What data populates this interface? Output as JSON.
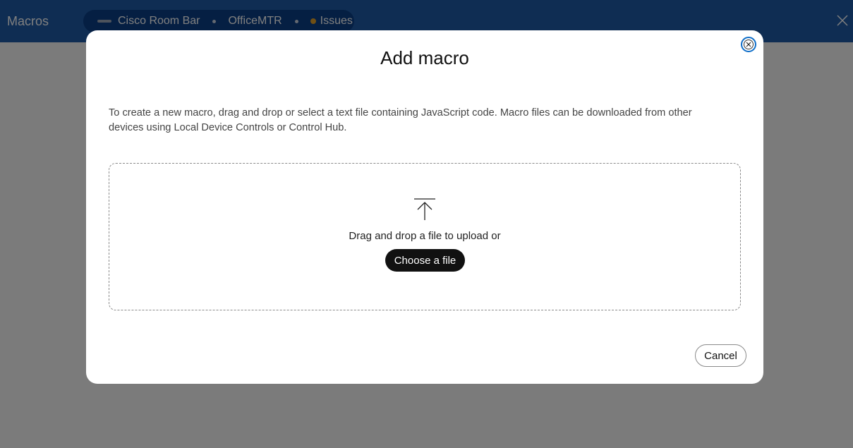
{
  "app": {
    "title": "Macros",
    "device": {
      "name": "Cisco Room Bar",
      "system": "OfficeMTR",
      "status": "Issues",
      "status_color": "#e0a02a"
    },
    "close_icon": "close-icon",
    "header_color": "#1f5aa6"
  },
  "modal": {
    "title": "Add macro",
    "description": "To create a new macro, drag and drop or select a text file containing JavaScript code. Macro files can be downloaded from other devices using Local Device Controls or Control Hub.",
    "close_icon": "close-circle-icon",
    "dropzone": {
      "icon": "upload-arrow-icon",
      "text": "Drag and drop a file to upload or",
      "button_label": "Choose a file"
    },
    "cancel_label": "Cancel"
  }
}
